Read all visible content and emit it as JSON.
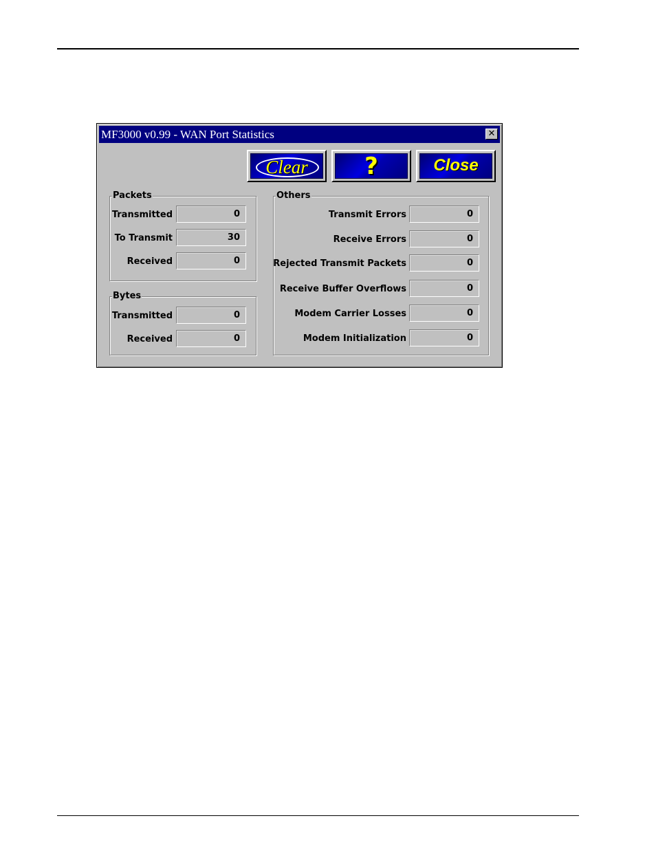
{
  "window": {
    "title": "MF3000 v0.99 - WAN Port Statistics",
    "close_glyph": "✕"
  },
  "toolbar": {
    "clear_label": "Clear",
    "help_label": "?",
    "close_label": "Close"
  },
  "packets": {
    "legend": "Packets",
    "transmitted_label": "Transmitted",
    "transmitted_value": "0",
    "to_transmit_label": "To Transmit",
    "to_transmit_value": "30",
    "received_label": "Received",
    "received_value": "0"
  },
  "bytes": {
    "legend": "Bytes",
    "transmitted_label": "Transmitted",
    "transmitted_value": "0",
    "received_label": "Received",
    "received_value": "0"
  },
  "others": {
    "legend": "Others",
    "transmit_errors_label": "Transmit Errors",
    "transmit_errors_value": "0",
    "receive_errors_label": "Receive Errors",
    "receive_errors_value": "0",
    "rejected_label": "Rejected Transmit Packets",
    "rejected_value": "0",
    "overflows_label": "Receive Buffer Overflows",
    "overflows_value": "0",
    "carrier_label": "Modem Carrier Losses",
    "carrier_value": "0",
    "init_label": "Modem Initialization",
    "init_value": "0"
  },
  "colors": {
    "titlebar": "#000080",
    "button_text": "#ffff00",
    "window_face": "#c0c0c0"
  }
}
